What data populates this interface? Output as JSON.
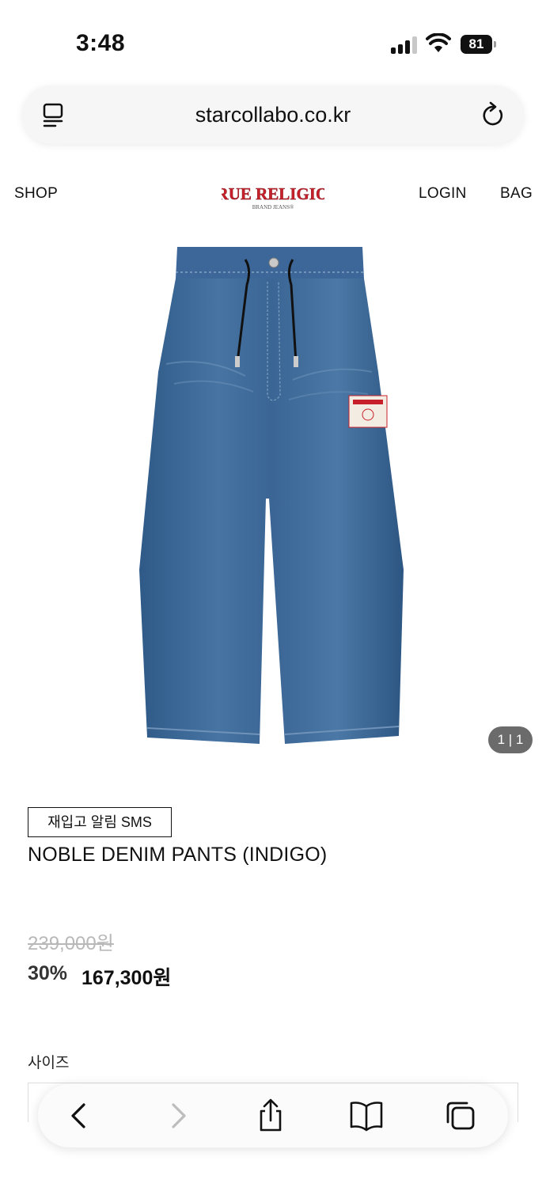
{
  "status_bar": {
    "time": "3:48",
    "battery": "81",
    "icons": [
      "signal-icon",
      "wifi-icon",
      "battery-icon"
    ]
  },
  "browser": {
    "url": "starcollabo.co.kr",
    "reader_icon": "reader-icon",
    "reload_icon": "reload-icon"
  },
  "header": {
    "shop": "SHOP",
    "login": "LOGIN",
    "bag": "BAG",
    "logo_text": "TRUE RELIGION",
    "logo_sub": "BRAND JEANS®"
  },
  "gallery": {
    "counter": "1 | 1"
  },
  "product": {
    "restock_button": "재입고 알림 SMS",
    "name": "NOBLE DENIM PANTS (INDIGO)",
    "original_price": "239,000원",
    "discount": "30%",
    "sale_price": "167,300원",
    "size_label": "사이즈"
  },
  "toolbar": {
    "icons": [
      "back-icon",
      "forward-icon",
      "share-icon",
      "bookmarks-icon",
      "tabs-icon"
    ]
  },
  "colors": {
    "logo_red": "#c8202a",
    "denim": "#3d6a9a",
    "counter_bg": "#6b6b6b"
  }
}
